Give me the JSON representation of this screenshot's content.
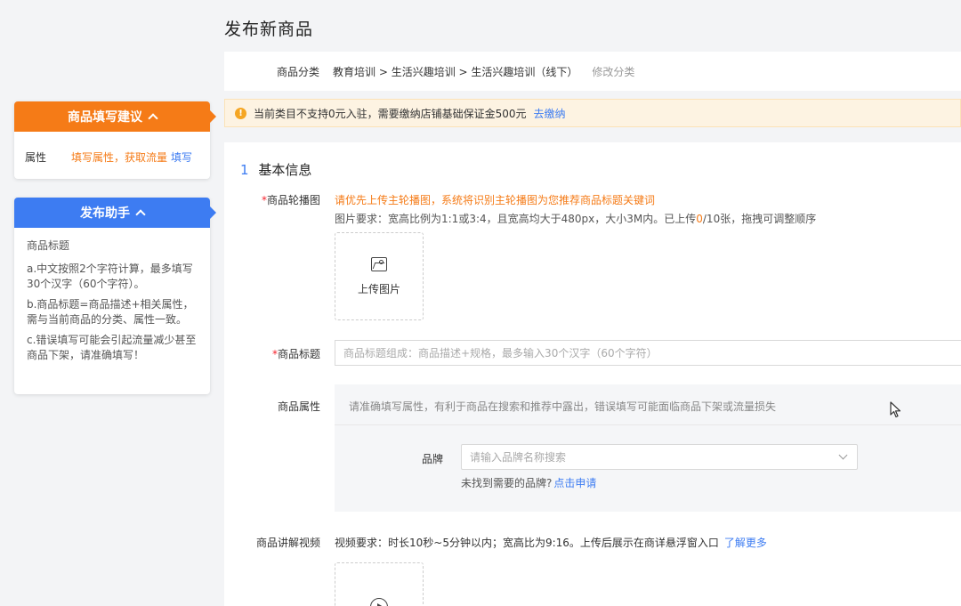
{
  "page": {
    "title": "发布新商品"
  },
  "sidebar": {
    "suggestion_card": {
      "title": "商品填写建议",
      "row_label": "属性",
      "row_tip": "填写属性，获取流量",
      "row_action": "填写"
    },
    "assistant_card": {
      "title": "发布助手",
      "heading": "商品标题",
      "tips": [
        "a.中文按照2个字符计算，最多填写30个汉字（60个字符）。",
        "b.商品标题=商品描述+相关属性，需与当前商品的分类、属性一致。",
        "c.错误填写可能会引起流量减少甚至商品下架，请准确填写！"
      ]
    }
  },
  "category": {
    "label": "商品分类",
    "path": "教育培训 > 生活兴趣培训 > 生活兴趣培训（线下）",
    "edit_label": "修改分类"
  },
  "notice": {
    "icon": "warning-icon",
    "text": "当前类目不支持0元入驻，需要缴纳店铺基础保证金500元",
    "action": "去缴纳"
  },
  "basic_info": {
    "section_number": "1",
    "section_title": "基本信息",
    "carousel": {
      "required_mark": "*",
      "label": "商品轮播图",
      "hint": "请优先上传主轮播图，系统将识别主轮播图为您推荐商品标题关键词",
      "req_prefix": "图片要求：宽高比例为1:1或3:4，且宽高均大于480px，大小3M内。已上传",
      "req_count": "0",
      "req_suffix": "/10张，拖拽可调整顺序",
      "upload_label": "上传图片"
    },
    "title": {
      "required_mark": "*",
      "label": "商品标题",
      "placeholder": "商品标题组成：商品描述+规格，最多输入30个汉字（60个字符）"
    },
    "attributes": {
      "label": "商品属性",
      "hint": "请准确填写属性，有利于商品在搜索和推荐中露出，错误填写可能面临商品下架或流量损失",
      "brand_label": "品牌",
      "brand_placeholder": "请输入品牌名称搜索",
      "brand_missing": "未找到需要的品牌?",
      "brand_apply": "点击申请"
    },
    "video": {
      "label": "商品讲解视频",
      "requirement": "视频要求：时长10秒~5分钟以内；宽高比为9:16。上传后展示在商详悬浮窗入口",
      "learn_more": "了解更多"
    }
  }
}
